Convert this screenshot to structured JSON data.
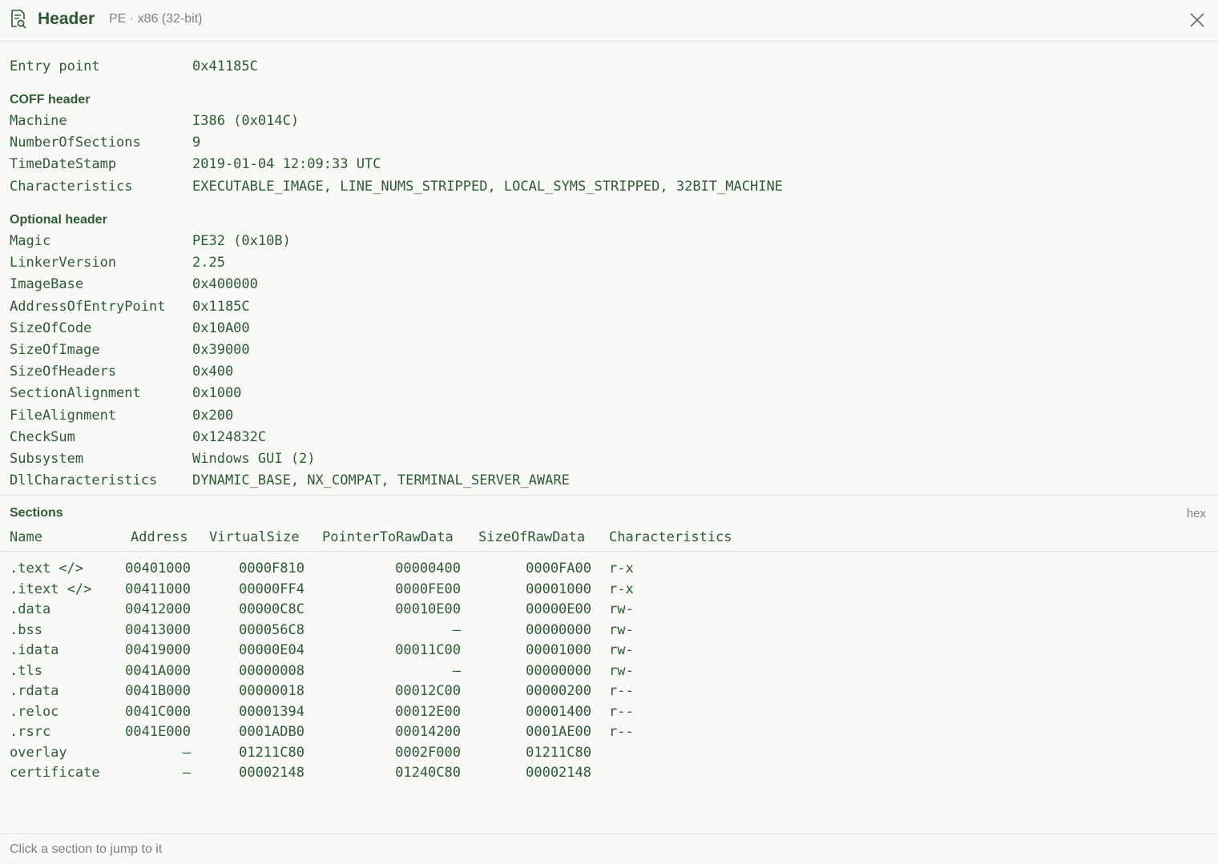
{
  "title_bar": {
    "title": "Header",
    "subtitle": "PE · x86 (32-bit)",
    "icon": "document-search-icon",
    "close_icon": "close-icon"
  },
  "entry": {
    "label": "Entry point",
    "value": "0x41185C"
  },
  "coff": {
    "title": "COFF header",
    "fields": [
      {
        "label": "Machine",
        "value": "I386 (0x014C)"
      },
      {
        "label": "NumberOfSections",
        "value": "9"
      },
      {
        "label": "TimeDateStamp",
        "value": "2019-01-04 12:09:33 UTC"
      },
      {
        "label": "Characteristics",
        "value": "EXECUTABLE_IMAGE, LINE_NUMS_STRIPPED, LOCAL_SYMS_STRIPPED, 32BIT_MACHINE"
      }
    ]
  },
  "optional": {
    "title": "Optional header",
    "fields": [
      {
        "label": "Magic",
        "value": "PE32 (0x10B)"
      },
      {
        "label": "LinkerVersion",
        "value": "2.25"
      },
      {
        "label": "ImageBase",
        "value": "0x400000"
      },
      {
        "label": "AddressOfEntryPoint",
        "value": "0x1185C"
      },
      {
        "label": "SizeOfCode",
        "value": "0x10A00"
      },
      {
        "label": "SizeOfImage",
        "value": "0x39000"
      },
      {
        "label": "SizeOfHeaders",
        "value": "0x400"
      },
      {
        "label": "SectionAlignment",
        "value": "0x1000"
      },
      {
        "label": "FileAlignment",
        "value": "0x200"
      },
      {
        "label": "CheckSum",
        "value": "0x124832C"
      },
      {
        "label": "Subsystem",
        "value": "Windows GUI (2)"
      },
      {
        "label": "DllCharacteristics",
        "value": "DYNAMIC_BASE, NX_COMPAT, TERMINAL_SERVER_AWARE"
      }
    ]
  },
  "sections": {
    "title": "Sections",
    "format_toggle": "hex",
    "columns": [
      "Name",
      "Address",
      "VirtualSize",
      "PointerToRawData",
      "SizeOfRawData",
      "Characteristics"
    ],
    "rows": [
      [
        ".text </>",
        "00401000",
        "0000F810",
        "00000400",
        "0000FA00",
        "r-x"
      ],
      [
        ".itext </>",
        "00411000",
        "00000FF4",
        "0000FE00",
        "00001000",
        "r-x"
      ],
      [
        ".data",
        "00412000",
        "00000C8C",
        "00010E00",
        "00000E00",
        "rw-"
      ],
      [
        ".bss",
        "00413000",
        "000056C8",
        "—",
        "00000000",
        "rw-"
      ],
      [
        ".idata",
        "00419000",
        "00000E04",
        "00011C00",
        "00001000",
        "rw-"
      ],
      [
        ".tls",
        "0041A000",
        "00000008",
        "—",
        "00000000",
        "rw-"
      ],
      [
        ".rdata",
        "0041B000",
        "00000018",
        "00012C00",
        "00000200",
        "r--"
      ],
      [
        ".reloc",
        "0041C000",
        "00001394",
        "00012E00",
        "00001400",
        "r--"
      ],
      [
        ".rsrc",
        "0041E000",
        "0001ADB0",
        "00014200",
        "0001AE00",
        "r--"
      ],
      [
        "overlay",
        "—",
        "01211C80",
        "0002F000",
        "01211C80",
        ""
      ],
      [
        "certificate",
        "—",
        "00002148",
        "01240C80",
        "00002148",
        ""
      ]
    ]
  },
  "footer": {
    "hint": "Click a section to jump to it"
  }
}
